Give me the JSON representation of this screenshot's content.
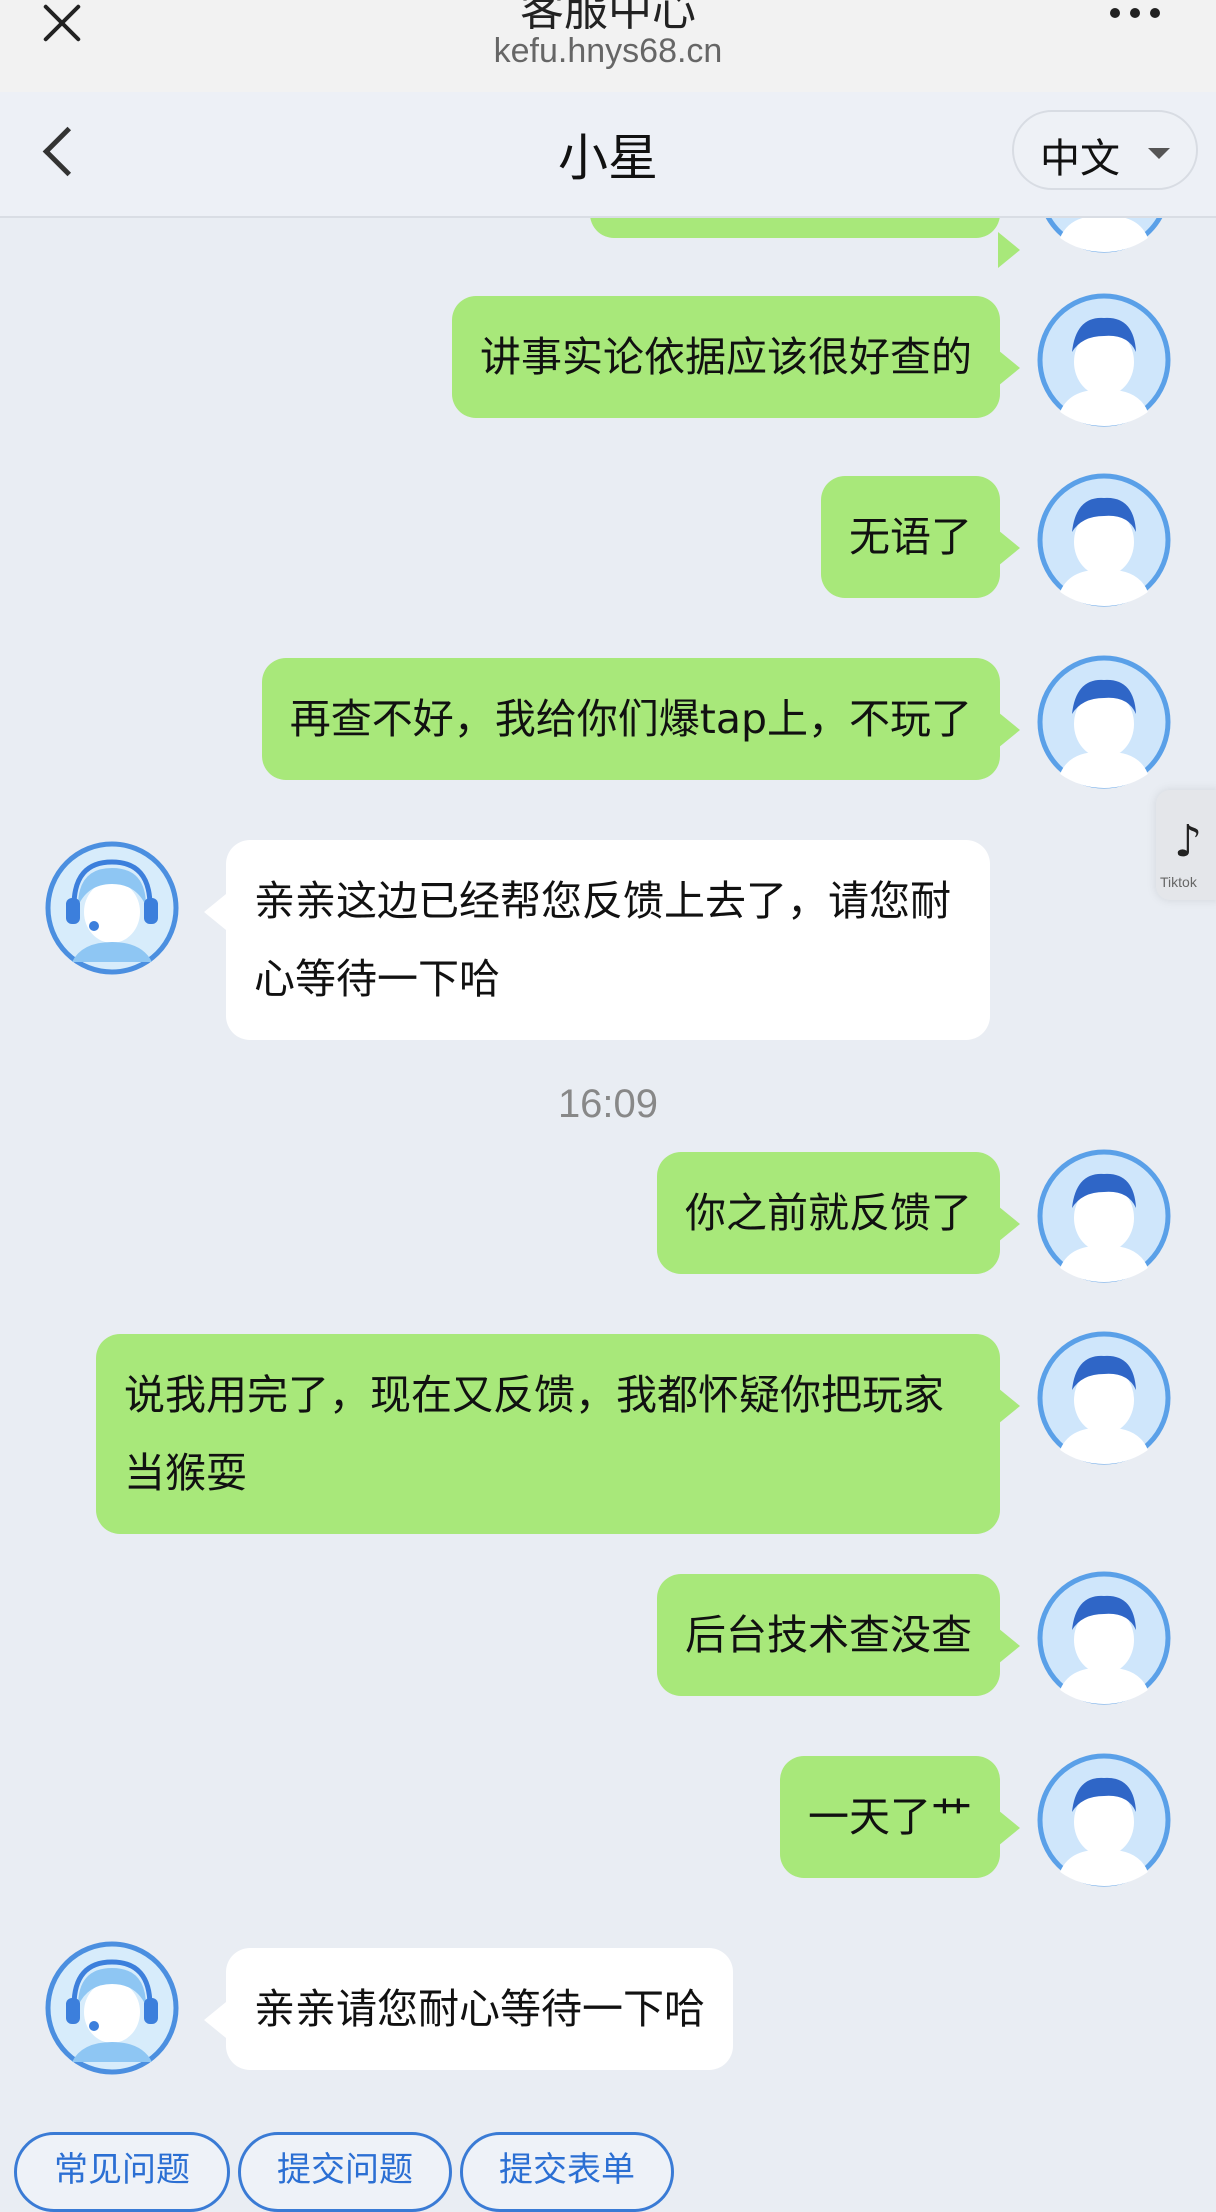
{
  "browser": {
    "title": "客服中心",
    "url": "kefu.hnys68.cn"
  },
  "header": {
    "agent_name": "小星",
    "language": "中文"
  },
  "messages": [
    {
      "from": "user",
      "text": "讲事实论依据应该很好查的"
    },
    {
      "from": "user",
      "text": "无语了"
    },
    {
      "from": "user",
      "text": "再查不好，我给你们爆tap上，不玩了"
    },
    {
      "from": "agent",
      "text": "亲亲这边已经帮您反馈上去了，请您耐心等待一下哈"
    },
    {
      "from": "time",
      "text": "16:09"
    },
    {
      "from": "user",
      "text": "你之前就反馈了"
    },
    {
      "from": "user",
      "text": "说我用完了，现在又反馈，我都怀疑你把玩家当猴耍"
    },
    {
      "from": "user",
      "text": "后台技术查没查"
    },
    {
      "from": "user",
      "text": "一天了艹"
    },
    {
      "from": "agent",
      "text": "亲亲请您耐心等待一下哈"
    }
  ],
  "floating_badge": {
    "label": "Tiktok"
  },
  "quick_actions": [
    {
      "label": "常见问题"
    },
    {
      "label": "提交问题"
    },
    {
      "label": "提交表单"
    }
  ],
  "colors": {
    "user_bubble": "#a8e87a",
    "agent_bubble": "#ffffff",
    "background": "#e9edf3",
    "accent": "#2b6fd3"
  }
}
